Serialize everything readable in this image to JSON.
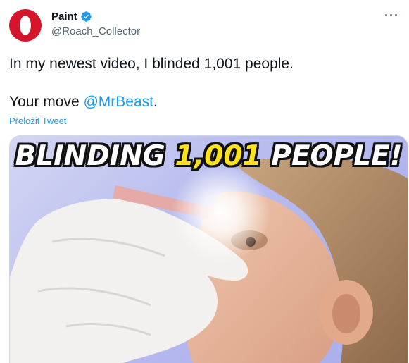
{
  "tweet": {
    "display_name": "Paint",
    "handle": "@Roach_Collector",
    "more_icon": "more-icon",
    "line1": "In my newest video, I blinded 1,001 people.",
    "line2_prefix": "Your move ",
    "mention": "@MrBeast",
    "line2_suffix": ".",
    "translate_label": "Přeložit Tweet"
  },
  "media": {
    "banner_part1": "BLINDING ",
    "banner_highlight": "1,001",
    "banner_part2": " PEOPLE!"
  },
  "colors": {
    "brand_avatar": "#d5152b",
    "link": "#1d9bf0",
    "verified": "#1d9bf0",
    "banner_highlight": "#ffe21a"
  }
}
